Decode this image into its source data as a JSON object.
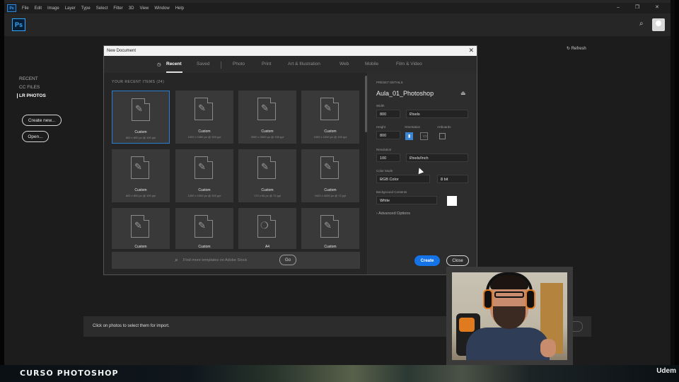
{
  "menubar": {
    "app_mini": "Ps",
    "items": [
      "File",
      "Edit",
      "Image",
      "Layer",
      "Type",
      "Select",
      "Filter",
      "3D",
      "View",
      "Window",
      "Help"
    ],
    "window_controls": "– ❐ ✕"
  },
  "home": {
    "logo": "Ps",
    "nav": [
      "RECENT",
      "CC FILES",
      "LR PHOTOS"
    ],
    "create_new_label": "Create new...",
    "open_label": "Open...",
    "refresh_label": "Refresh",
    "import_hint": "Click on photos to select them for import."
  },
  "dialog": {
    "title": "New Document",
    "close_glyph": "✕",
    "tabs": [
      "Recent",
      "Saved",
      "Photo",
      "Print",
      "Art & Illustration",
      "Web",
      "Mobile",
      "Film & Video"
    ],
    "recent_heading": "YOUR RECENT ITEMS  (24)",
    "recent_items": [
      {
        "name": "Custom",
        "size": "800 x 800 px @ 100 ppi"
      },
      {
        "name": "Custom",
        "size": "1920 x 1080 px @ 300 ppi"
      },
      {
        "name": "Custom",
        "size": "3000 x 3000 px @ 150 ppi"
      },
      {
        "name": "Custom",
        "size": "1000 x 1000 px @ 150 ppi"
      },
      {
        "name": "Custom",
        "size": "800 x 800 px @ 100 ppi"
      },
      {
        "name": "Custom",
        "size": "1000 x 1000 px @ 300 ppi"
      },
      {
        "name": "Custom",
        "size": "170 x 64 px @ 72 ppi"
      },
      {
        "name": "Custom",
        "size": "1920 x 4000 px @ 72 ppi"
      },
      {
        "name": "Custom",
        "size": ""
      },
      {
        "name": "Custom",
        "size": ""
      },
      {
        "name": "A4",
        "size": ""
      },
      {
        "name": "Custom",
        "size": ""
      }
    ],
    "search_placeholder": "Find more templates on Adobe Stock",
    "go_label": "Go",
    "preset": {
      "heading": "PRESET DETAILS",
      "name": "Aula_01_Photoshop",
      "width_label": "Width",
      "width_value": "800",
      "width_unit": "Pixels",
      "height_label": "Height",
      "height_value": "800",
      "orientation_label": "Orientation",
      "artboards_label": "Artboards",
      "resolution_label": "Resolution",
      "resolution_value": "100",
      "resolution_unit": "Pixels/Inch",
      "color_mode_label": "Color Mode",
      "color_mode_value": "RGB Color",
      "bit_depth_value": "8 bit",
      "background_label": "Background Contents",
      "background_value": "White",
      "advanced_label": "Advanced Options"
    },
    "create_label": "Create",
    "close_label": "Close"
  },
  "footer": {
    "brand": "CURSO PHOTOSHOP",
    "udemy": "Udem"
  },
  "colors": {
    "accent_blue": "#1473e6",
    "ps_blue": "#31a8ff",
    "panel_dark": "#262626"
  }
}
